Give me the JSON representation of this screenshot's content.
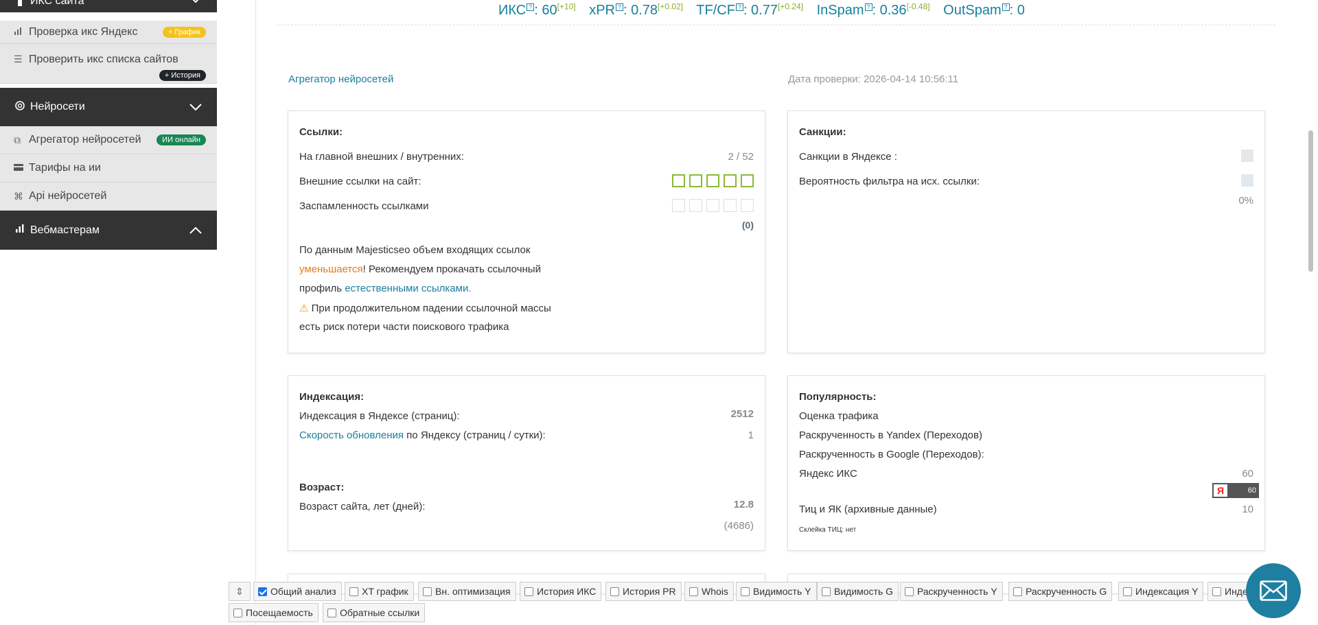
{
  "sidebar": {
    "section_top": "ИКС сайта",
    "items_top": [
      {
        "label": "Проверка икс Яндекс",
        "badge": "+ График"
      },
      {
        "label": "Проверить икс списка сайтов",
        "badge": "+ История"
      }
    ],
    "section_ai": "Нейросети",
    "items_ai": [
      {
        "label": "Агрегатор нейросетей",
        "badge": "ИИ онлайн"
      },
      {
        "label": "Тарифы на ии"
      },
      {
        "label": "Api нейросетей"
      }
    ],
    "section_web": "Вебмастерам"
  },
  "metrics": [
    {
      "name": "ИКС",
      "q": "?",
      "value": ": 60",
      "delta": "[+10]"
    },
    {
      "name": "xPR",
      "q": "?",
      "value": ": 0.78",
      "delta": "[+0.02]"
    },
    {
      "name": "TF/CF",
      "q": "?",
      "value": ": 0.77",
      "delta": "[+0.24]"
    },
    {
      "name": "InSpam",
      "q": "?",
      "value": ": 0.36",
      "delta": "[-0.48]"
    },
    {
      "name": "OutSpam",
      "q": "?",
      "value": ": 0",
      "delta": ""
    }
  ],
  "header": {
    "aggregator_link": "Агрегатор нейросетей",
    "check_date": "Дата проверки: 2026-04-14 10:56:11"
  },
  "links_card": {
    "title": "Ссылки:",
    "row1_label": "На главной внешних / внутренних:",
    "row1_value": "2 / 52",
    "row2_label": "Внешние ссылки на сайт:",
    "row3_label": "Заспамленность ссылками",
    "row3_value": "(0)",
    "text1": "По данным Majesticseo объем входящих ссылок",
    "text2_orange": "уменьшается",
    "text2_rest": "! Рекомендуем прокачать ссылочный",
    "text3": "профиль ",
    "text3_link": "естественными ссылками.",
    "text4": "При продолжительном падении ссылочной массы",
    "text5": "есть риск потери части поискового трафика"
  },
  "sanctions_card": {
    "title": "Санкции:",
    "row1_label": "Санкции в Яндексе :",
    "row2_label": "Вероятность фильтра на исх. ссылки:",
    "row2_value": "0%"
  },
  "index_card": {
    "title": "Индексация:",
    "row1_label": "Индексация в Яндексе (страниц):",
    "row1_value": "2512",
    "row2_link": "Скорость обновления",
    "row2_rest": " по Яндексу (страниц / сутки):",
    "row2_value": "1",
    "age_title": "Возраст:",
    "age_label": "Возраст сайта, лет (дней):",
    "age_value": "12.8",
    "age_days": "(4686)"
  },
  "popularity_card": {
    "title": "Популярность:",
    "row1_link": "Оценка трафика",
    "row2_label": "Раскрученность в Yandex (Переходов)",
    "row3_label": "Раскрученность в Google (Переходов):",
    "row4_link": "Яндекс ИКС",
    "row4_value": "60",
    "badge_letter": "Я",
    "badge_value": "60",
    "row5_label": "Тиц и ЯК (архивные данные)",
    "row5_value": "10",
    "glue": "Склейка ТИЦ: нет"
  },
  "toolbar": {
    "items": [
      {
        "label": "Общий анализ",
        "checked": true
      },
      {
        "label": "XT график",
        "checked": false
      },
      {
        "label": "Вн. оптимизация",
        "checked": false
      },
      {
        "label": "История ИКС",
        "checked": false
      },
      {
        "label": "История PR",
        "checked": false
      },
      {
        "label": "Whois",
        "checked": false
      },
      {
        "label": "Видимость Y",
        "checked": false
      },
      {
        "label": "Видимость G",
        "checked": false
      },
      {
        "label": "Раскрученность Y",
        "checked": false
      },
      {
        "label": "Раскрученность G",
        "checked": false
      },
      {
        "label": "Индексация Y",
        "checked": false
      },
      {
        "label": "Инде",
        "checked": false
      },
      {
        "label": "Посещаемость",
        "checked": false
      },
      {
        "label": "Обратные ссылки",
        "checked": false
      }
    ]
  },
  "colors": {
    "accent": "#1a7ea0",
    "sidebar_dark": "#333333",
    "green": "#84b02e",
    "orange": "#e8a116"
  }
}
